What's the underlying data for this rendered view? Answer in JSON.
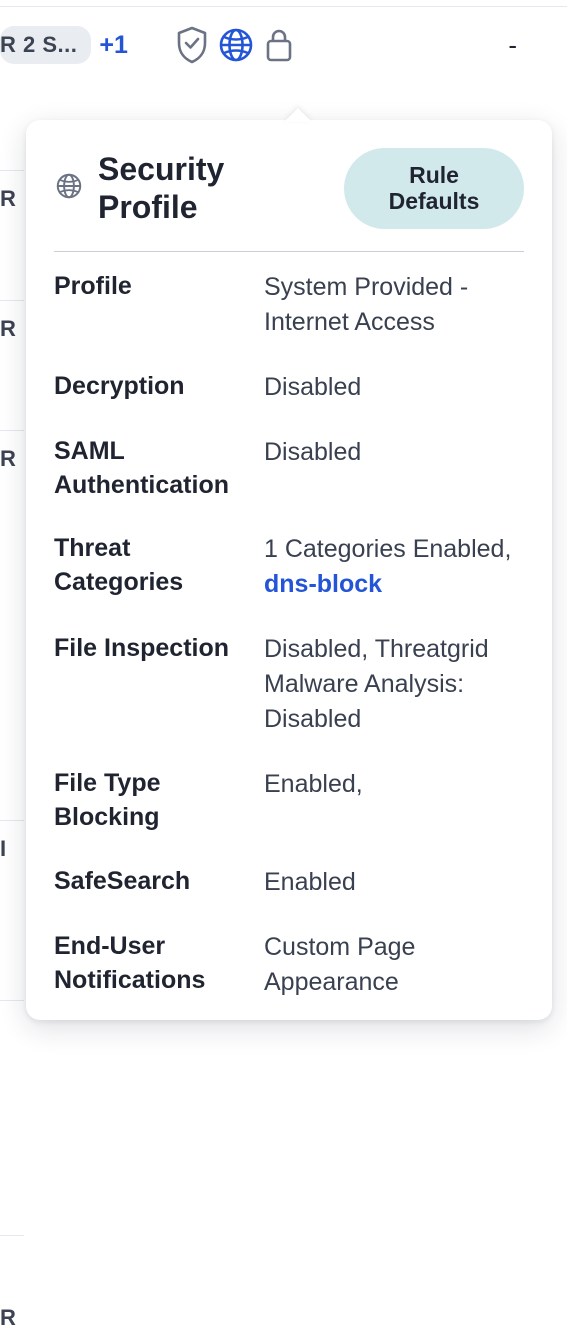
{
  "header": {
    "chip_label": "R 2 S...",
    "plus_link": "+1",
    "dash": "-"
  },
  "popover": {
    "title": "Security Profile",
    "badge": "Rule Defaults",
    "rows": {
      "profile": {
        "label": "Profile",
        "value": "System Provided - Internet Access"
      },
      "decryption": {
        "label": "Decryption",
        "value": "Disabled"
      },
      "saml": {
        "label": "SAML Authentication",
        "value": "Disabled"
      },
      "threat": {
        "label": "Threat Categories",
        "value_prefix": "1 Categories Enabled, ",
        "link": "dns-block"
      },
      "file_inspect": {
        "label": "File Inspection",
        "value": "Disabled, Threatgrid Malware Analysis: Disabled"
      },
      "file_type": {
        "label": "File Type Blocking",
        "value": "Enabled,"
      },
      "safesearch": {
        "label": "SafeSearch",
        "value": "Enabled"
      },
      "eun": {
        "label": "End-User Notifications",
        "value": "Custom Page Appearance"
      }
    }
  },
  "bg": {
    "r1": "R",
    "r2": "R",
    "r3": "R",
    "r4": "I",
    "r5": "R"
  },
  "colors": {
    "link": "#2455d6",
    "badge_bg": "#d2e9ec"
  }
}
